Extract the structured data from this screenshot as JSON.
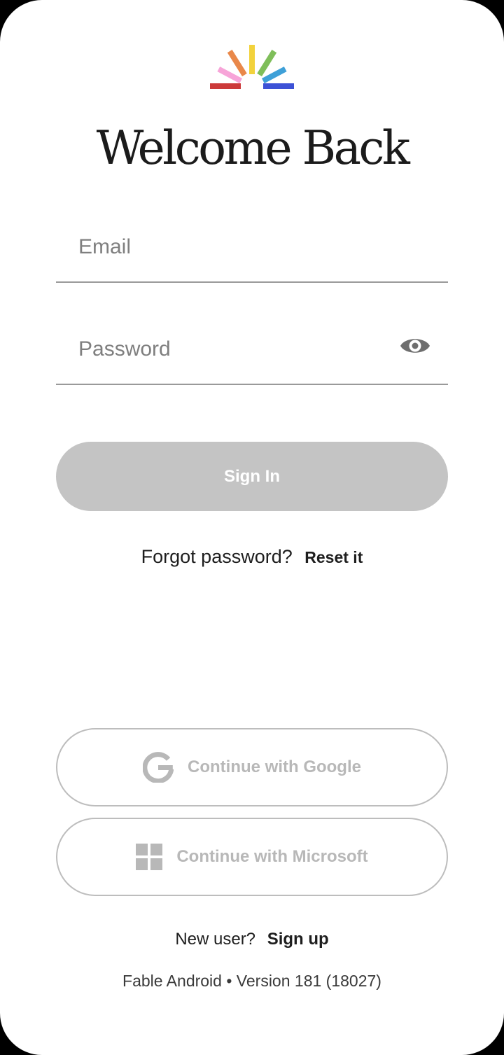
{
  "header": {
    "title": "Welcome Back"
  },
  "form": {
    "email_placeholder": "Email",
    "email_value": "",
    "password_placeholder": "Password",
    "password_value": "",
    "signin_label": "Sign In"
  },
  "forgot": {
    "text": "Forgot password?",
    "link": "Reset it"
  },
  "oauth": {
    "google_label": "Continue with Google",
    "microsoft_label": "Continue with Microsoft"
  },
  "signup": {
    "text": "New user?",
    "link": "Sign up"
  },
  "footer": {
    "version": "Fable Android • Version 181 (18027)"
  },
  "icons": {
    "logo": "fable-logo",
    "eye": "eye-icon",
    "google": "google-icon",
    "microsoft": "windows-icon"
  },
  "colors": {
    "disabled_button": "#c4c4c4",
    "disabled_text": "#b8b8b8",
    "logo_red": "#cc3a3a",
    "logo_pink": "#f7a4d8",
    "logo_orange": "#e9884a",
    "logo_yellow": "#f2d23c",
    "logo_green": "#7fbe5a",
    "logo_blue": "#3ea0d8",
    "logo_indigo": "#3d52d6"
  }
}
